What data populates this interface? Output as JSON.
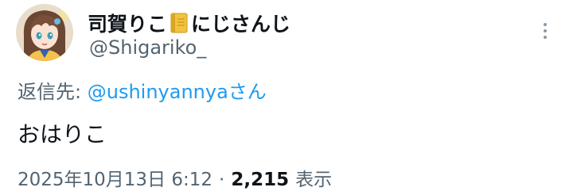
{
  "author": {
    "display_name": "司賀りこ",
    "display_name_suffix": "にじさんじ",
    "badge_icon": "notebook-icon",
    "handle": "@Shigariko_",
    "avatar_icon": "anime-character-avatar"
  },
  "reply": {
    "prefix": "返信先:",
    "target_handle": "@ushinyannya",
    "suffix": "さん"
  },
  "tweet": {
    "text": "おはりこ"
  },
  "meta": {
    "timestamp": "2025年10月13日 6:12",
    "separator": "·",
    "views_count": "2,215",
    "views_label": "表示"
  },
  "colors": {
    "link": "#1d9bf0",
    "secondary_text": "#536471",
    "primary_text": "#0f1419"
  }
}
